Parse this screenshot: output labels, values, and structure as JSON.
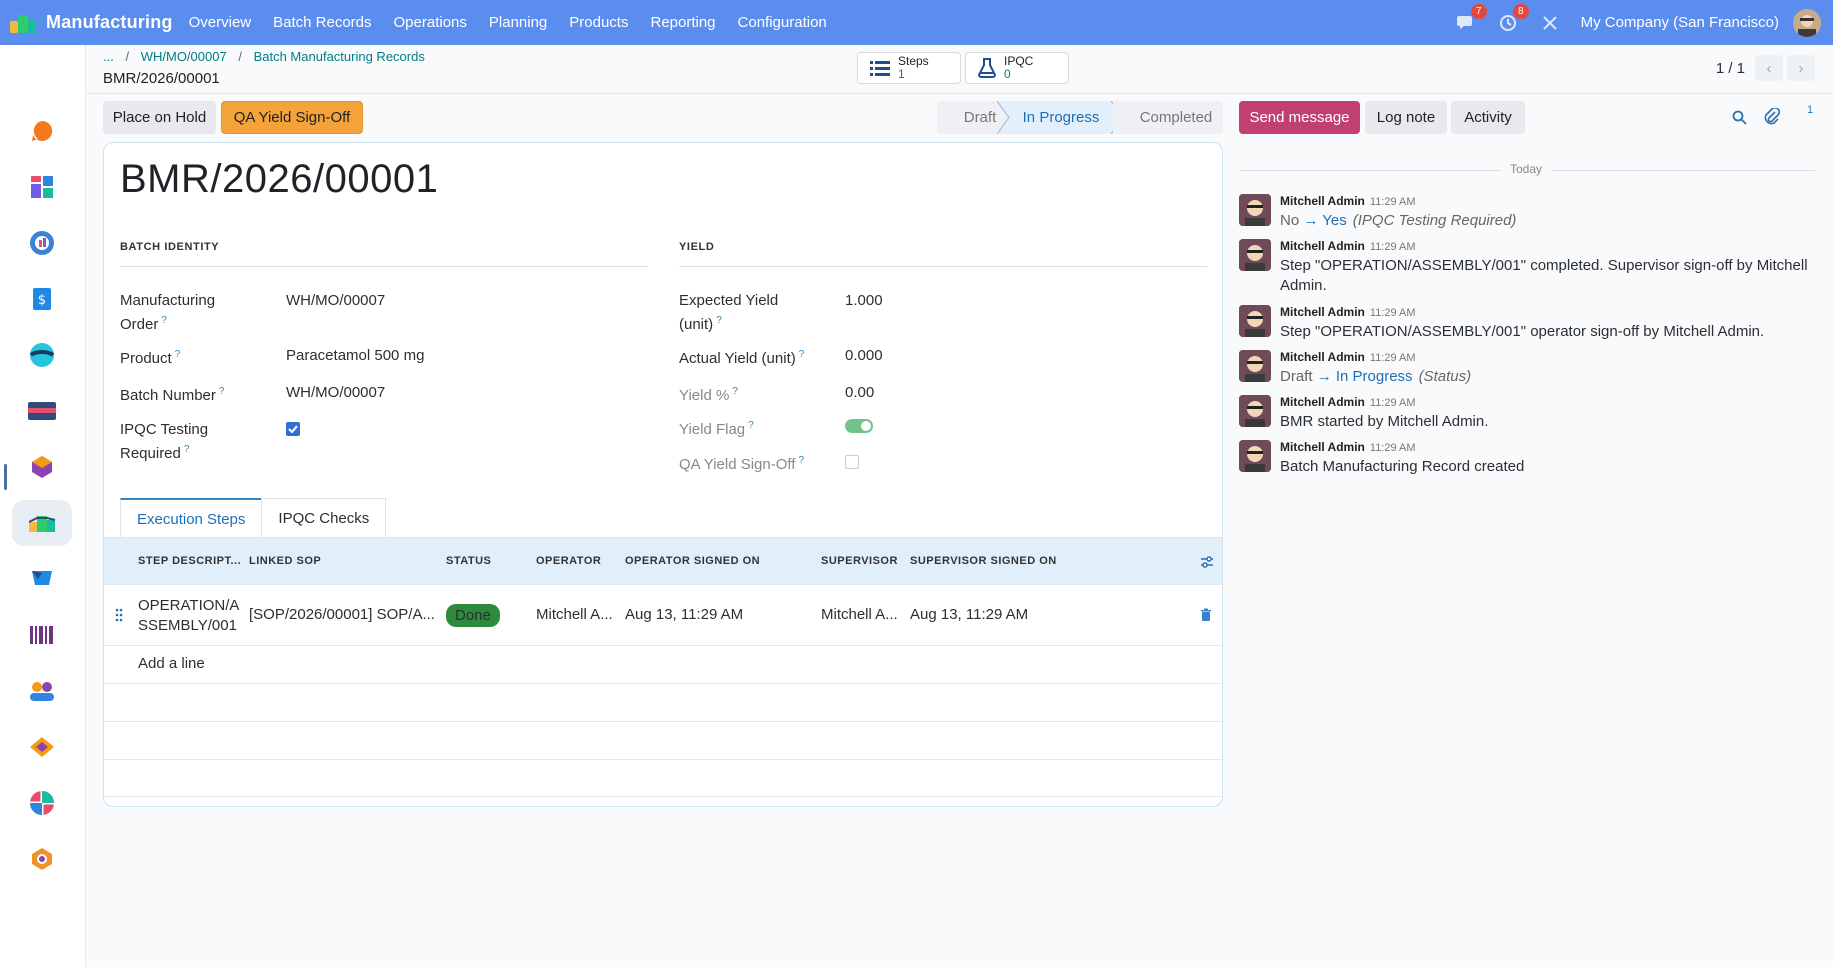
{
  "topbar": {
    "app_name": "Manufacturing",
    "menu": [
      "Overview",
      "Batch Records",
      "Operations",
      "Planning",
      "Products",
      "Reporting",
      "Configuration"
    ],
    "messages_count": "7",
    "activities_count": "8",
    "company": "My Company (San Francisco)"
  },
  "breadcrumb": {
    "ellipsis": "...",
    "items": [
      "WH/MO/00007",
      "Batch Manufacturing Records"
    ],
    "current": "BMR/2026/00001"
  },
  "smart_buttons": {
    "steps": {
      "label": "Steps",
      "value": "1"
    },
    "ipqc": {
      "label": "IPQC",
      "value": "0"
    }
  },
  "pager": {
    "value": "1 / 1"
  },
  "actions": {
    "hold": "Place on Hold",
    "signoff": "QA Yield Sign-Off"
  },
  "status": {
    "stages": [
      "Draft",
      "In Progress",
      "Completed"
    ],
    "current": "In Progress"
  },
  "chatter_buttons": {
    "send": "Send message",
    "log": "Log note",
    "activity": "Activity",
    "followers": "1"
  },
  "form": {
    "title": "BMR/2026/00001",
    "batch_identity": {
      "heading": "BATCH IDENTITY",
      "mo_label_1": "Manufacturing",
      "mo_label_2": "Order",
      "mo_value": "WH/MO/00007",
      "product_label": "Product",
      "product_value": "Paracetamol 500 mg",
      "batch_label": "Batch Number",
      "batch_value": "WH/MO/00007",
      "ipqc_label_1": "IPQC Testing",
      "ipqc_label_2": "Required",
      "ipqc_checked": true
    },
    "yield": {
      "heading": "YIELD",
      "expected_label_1": "Expected Yield",
      "expected_label_2": "(unit)",
      "expected_value": "1.000",
      "actual_label": "Actual Yield (unit)",
      "actual_value": "0.000",
      "pct_label": "Yield %",
      "pct_value": "0.00",
      "flag_label": "Yield Flag",
      "flag_on": true,
      "qa_label": "QA Yield Sign-Off",
      "qa_checked": false
    },
    "help_mark": "?"
  },
  "tabs": [
    "Execution Steps",
    "IPQC Checks"
  ],
  "grid": {
    "headers": [
      "STEP DESCRIPT...",
      "LINKED SOP",
      "STATUS",
      "OPERATOR",
      "OPERATOR SIGNED ON",
      "SUPERVISOR",
      "SUPERVISOR SIGNED ON"
    ],
    "rows": [
      {
        "step_1": "OPERATION/A",
        "step_2": "SSEMBLY/001",
        "sop": "[SOP/2026/00001] SOP/A...",
        "status": "Done",
        "operator": "Mitchell A...",
        "operator_signed": "Aug 13, 11:29 AM",
        "supervisor": "Mitchell A...",
        "supervisor_signed": "Aug 13, 11:29 AM"
      }
    ],
    "add_line": "Add a line"
  },
  "chatter": {
    "date_separator": "Today",
    "messages": [
      {
        "author": "Mitchell Admin",
        "time": "11:29 AM",
        "old": "No",
        "arrow": "→",
        "new": "Yes",
        "field": "(IPQC Testing Required)"
      },
      {
        "author": "Mitchell Admin",
        "time": "11:29 AM",
        "text": "Step \"OPERATION/ASSEMBLY/001\" completed. Supervisor sign-off by Mitchell Admin."
      },
      {
        "author": "Mitchell Admin",
        "time": "11:29 AM",
        "text": "Step \"OPERATION/ASSEMBLY/001\" operator sign-off by Mitchell Admin."
      },
      {
        "author": "Mitchell Admin",
        "time": "11:29 AM",
        "old": "Draft",
        "arrow": "→",
        "new": "In Progress",
        "field": "(Status)"
      },
      {
        "author": "Mitchell Admin",
        "time": "11:29 AM",
        "text": "BMR started by Mitchell Admin."
      },
      {
        "author": "Mitchell Admin",
        "time": "11:29 AM",
        "text": "Batch Manufacturing Record created"
      }
    ]
  },
  "sidebar_apps": [
    "discuss-app-icon",
    "dashboards-app-icon",
    "crm-app-icon",
    "invoicing-app-icon",
    "project-app-icon",
    "accounting-app-icon",
    "inventory-app-icon",
    "manufacturing-app-icon",
    "purchase-app-icon",
    "barcode-app-icon",
    "employees-app-icon",
    "sales-app-icon",
    "documents-app-icon",
    "settings-app-icon"
  ],
  "colors": {
    "navbar": "#5b8def",
    "primary": "#c0406f",
    "accent": "#017e84",
    "done": "#2e8b3e"
  }
}
